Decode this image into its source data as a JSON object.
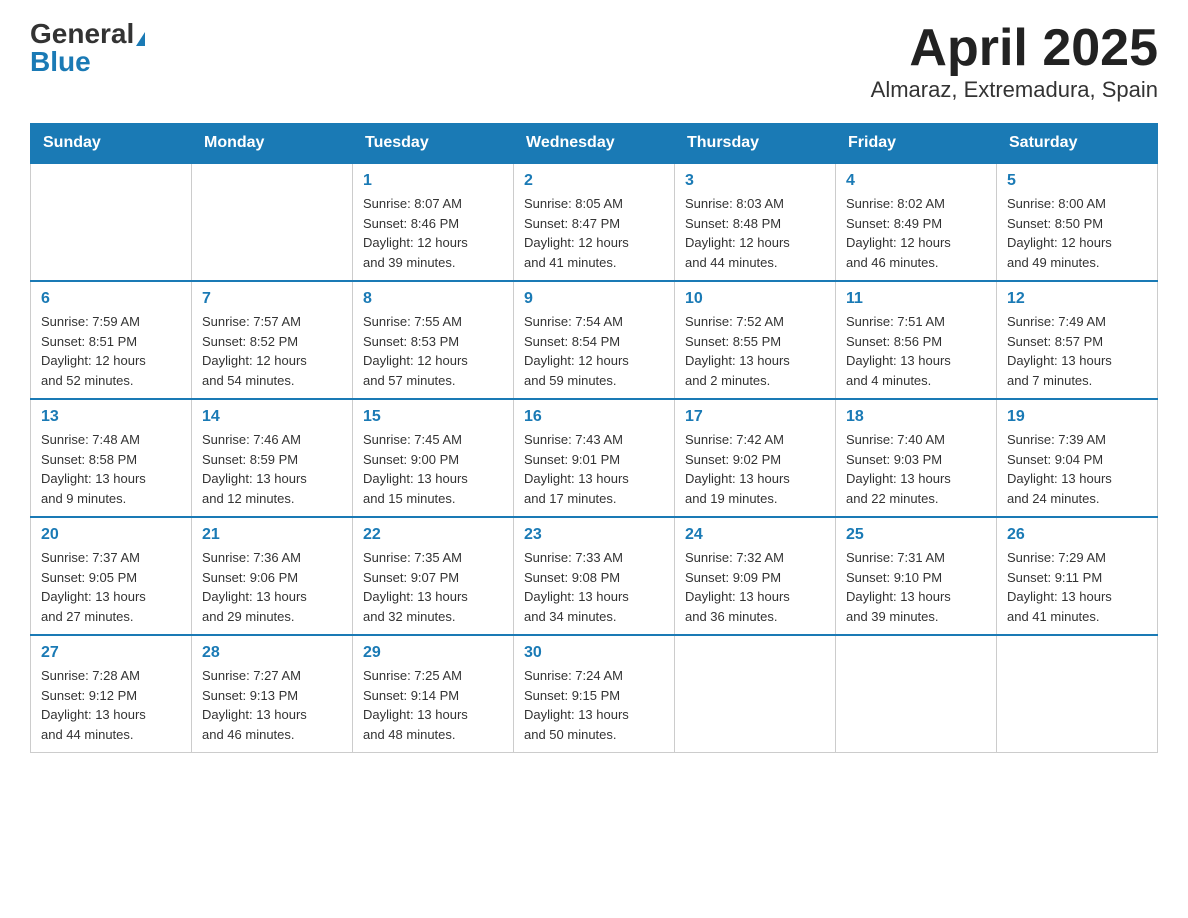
{
  "header": {
    "logo_general": "General",
    "logo_blue": "Blue",
    "title": "April 2025",
    "location": "Almaraz, Extremadura, Spain"
  },
  "days_of_week": [
    "Sunday",
    "Monday",
    "Tuesday",
    "Wednesday",
    "Thursday",
    "Friday",
    "Saturday"
  ],
  "weeks": [
    [
      {
        "day": "",
        "info": ""
      },
      {
        "day": "",
        "info": ""
      },
      {
        "day": "1",
        "info": "Sunrise: 8:07 AM\nSunset: 8:46 PM\nDaylight: 12 hours\nand 39 minutes."
      },
      {
        "day": "2",
        "info": "Sunrise: 8:05 AM\nSunset: 8:47 PM\nDaylight: 12 hours\nand 41 minutes."
      },
      {
        "day": "3",
        "info": "Sunrise: 8:03 AM\nSunset: 8:48 PM\nDaylight: 12 hours\nand 44 minutes."
      },
      {
        "day": "4",
        "info": "Sunrise: 8:02 AM\nSunset: 8:49 PM\nDaylight: 12 hours\nand 46 minutes."
      },
      {
        "day": "5",
        "info": "Sunrise: 8:00 AM\nSunset: 8:50 PM\nDaylight: 12 hours\nand 49 minutes."
      }
    ],
    [
      {
        "day": "6",
        "info": "Sunrise: 7:59 AM\nSunset: 8:51 PM\nDaylight: 12 hours\nand 52 minutes."
      },
      {
        "day": "7",
        "info": "Sunrise: 7:57 AM\nSunset: 8:52 PM\nDaylight: 12 hours\nand 54 minutes."
      },
      {
        "day": "8",
        "info": "Sunrise: 7:55 AM\nSunset: 8:53 PM\nDaylight: 12 hours\nand 57 minutes."
      },
      {
        "day": "9",
        "info": "Sunrise: 7:54 AM\nSunset: 8:54 PM\nDaylight: 12 hours\nand 59 minutes."
      },
      {
        "day": "10",
        "info": "Sunrise: 7:52 AM\nSunset: 8:55 PM\nDaylight: 13 hours\nand 2 minutes."
      },
      {
        "day": "11",
        "info": "Sunrise: 7:51 AM\nSunset: 8:56 PM\nDaylight: 13 hours\nand 4 minutes."
      },
      {
        "day": "12",
        "info": "Sunrise: 7:49 AM\nSunset: 8:57 PM\nDaylight: 13 hours\nand 7 minutes."
      }
    ],
    [
      {
        "day": "13",
        "info": "Sunrise: 7:48 AM\nSunset: 8:58 PM\nDaylight: 13 hours\nand 9 minutes."
      },
      {
        "day": "14",
        "info": "Sunrise: 7:46 AM\nSunset: 8:59 PM\nDaylight: 13 hours\nand 12 minutes."
      },
      {
        "day": "15",
        "info": "Sunrise: 7:45 AM\nSunset: 9:00 PM\nDaylight: 13 hours\nand 15 minutes."
      },
      {
        "day": "16",
        "info": "Sunrise: 7:43 AM\nSunset: 9:01 PM\nDaylight: 13 hours\nand 17 minutes."
      },
      {
        "day": "17",
        "info": "Sunrise: 7:42 AM\nSunset: 9:02 PM\nDaylight: 13 hours\nand 19 minutes."
      },
      {
        "day": "18",
        "info": "Sunrise: 7:40 AM\nSunset: 9:03 PM\nDaylight: 13 hours\nand 22 minutes."
      },
      {
        "day": "19",
        "info": "Sunrise: 7:39 AM\nSunset: 9:04 PM\nDaylight: 13 hours\nand 24 minutes."
      }
    ],
    [
      {
        "day": "20",
        "info": "Sunrise: 7:37 AM\nSunset: 9:05 PM\nDaylight: 13 hours\nand 27 minutes."
      },
      {
        "day": "21",
        "info": "Sunrise: 7:36 AM\nSunset: 9:06 PM\nDaylight: 13 hours\nand 29 minutes."
      },
      {
        "day": "22",
        "info": "Sunrise: 7:35 AM\nSunset: 9:07 PM\nDaylight: 13 hours\nand 32 minutes."
      },
      {
        "day": "23",
        "info": "Sunrise: 7:33 AM\nSunset: 9:08 PM\nDaylight: 13 hours\nand 34 minutes."
      },
      {
        "day": "24",
        "info": "Sunrise: 7:32 AM\nSunset: 9:09 PM\nDaylight: 13 hours\nand 36 minutes."
      },
      {
        "day": "25",
        "info": "Sunrise: 7:31 AM\nSunset: 9:10 PM\nDaylight: 13 hours\nand 39 minutes."
      },
      {
        "day": "26",
        "info": "Sunrise: 7:29 AM\nSunset: 9:11 PM\nDaylight: 13 hours\nand 41 minutes."
      }
    ],
    [
      {
        "day": "27",
        "info": "Sunrise: 7:28 AM\nSunset: 9:12 PM\nDaylight: 13 hours\nand 44 minutes."
      },
      {
        "day": "28",
        "info": "Sunrise: 7:27 AM\nSunset: 9:13 PM\nDaylight: 13 hours\nand 46 minutes."
      },
      {
        "day": "29",
        "info": "Sunrise: 7:25 AM\nSunset: 9:14 PM\nDaylight: 13 hours\nand 48 minutes."
      },
      {
        "day": "30",
        "info": "Sunrise: 7:24 AM\nSunset: 9:15 PM\nDaylight: 13 hours\nand 50 minutes."
      },
      {
        "day": "",
        "info": ""
      },
      {
        "day": "",
        "info": ""
      },
      {
        "day": "",
        "info": ""
      }
    ]
  ]
}
